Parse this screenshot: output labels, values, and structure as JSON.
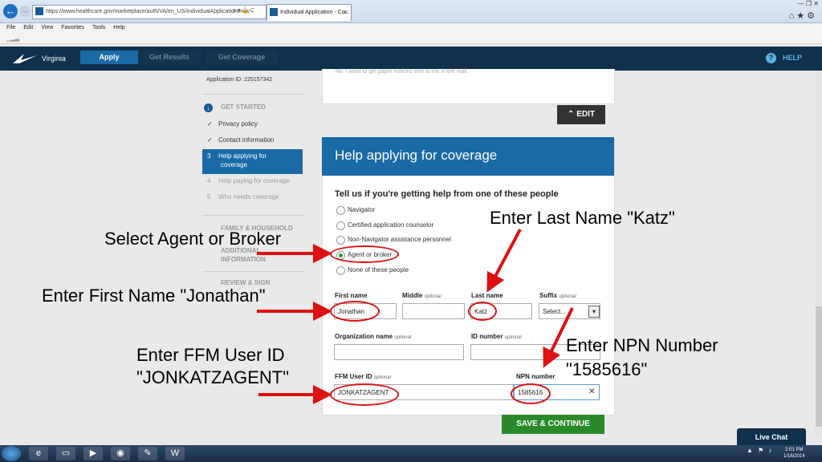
{
  "browser": {
    "url": "https://www.healthcare.gov/marketplace/auth/VA/en_US/individualApplication#nav",
    "url_tools": "ρ ▾ 🔒 C",
    "tab_title": "Individual Application - Co...",
    "menu": [
      "File",
      "Edit",
      "View",
      "Favorites",
      "Tools",
      "Help"
    ],
    "window_controls": "— ❐ ✕",
    "toolbar_icons": "⌂★⚙"
  },
  "header": {
    "state": "Virginia",
    "steps": [
      "Apply",
      "Get Results",
      "Get Coverage"
    ],
    "help": "HELP",
    "help_icon_glyph": "?"
  },
  "sidebar": {
    "application_id": "Application ID: 225157342",
    "section_get_started": "GET STARTED",
    "items": [
      {
        "mark": "✓",
        "label": "Privacy policy"
      },
      {
        "mark": "✓",
        "label": "Contact information"
      },
      {
        "mark": "3",
        "label": "Help applying for",
        "label2": "coverage"
      },
      {
        "mark": "4",
        "label": "Help paying for coverage"
      },
      {
        "mark": "5",
        "label": "Who needs coverage"
      }
    ],
    "section_family": "FAMILY & HOUSEHOLD",
    "section_additional": "ADDITIONAL",
    "section_additional2": "INFORMATION",
    "section_review": "REVIEW & SIGN"
  },
  "prev_card": {
    "faded_text": "No, I want to get paper notices sent to me in the mail.",
    "edit_label": "EDIT"
  },
  "form": {
    "title": "Help applying for coverage",
    "question": "Tell us if you're getting help from one of these people",
    "options": [
      "Navigator",
      "Certified application counselor",
      "Non-Navigator assistance personnel",
      "Agent or broker",
      "None of these people"
    ],
    "selected_option": "Agent or broker",
    "first_name_label": "First name",
    "first_name_value": "Jonathan",
    "middle_label": "Middle",
    "middle_optional": "optional",
    "last_name_label": "Last name",
    "last_name_value": "Katz",
    "suffix_label": "Suffix",
    "suffix_optional": "optional",
    "suffix_value": "Select...",
    "org_label": "Organization name",
    "org_optional": "optional",
    "id_label": "ID number",
    "id_optional": "optional",
    "ffm_label": "FFM User ID",
    "ffm_optional": "optional",
    "ffm_value": "JONKATZAGENT",
    "npn_label": "NPN number",
    "npn_value": "1585616",
    "save_label": "SAVE & CONTINUE"
  },
  "live_chat": "Live Chat",
  "taskbar": {
    "time": "2:01 PM",
    "date": "1/16/2014"
  },
  "annotations": {
    "select_agent": "Select Agent or Broker",
    "enter_first": "Enter First Name \"Jonathan\"",
    "enter_ffm_1": "Enter FFM User ID",
    "enter_ffm_2": "\"JONKATZAGENT\"",
    "enter_last": "Enter Last Name \"Katz\"",
    "enter_npn_1": "Enter NPN Number",
    "enter_npn_2": "\"1585616\""
  },
  "colors": {
    "header_bg": "#10304c",
    "accent_blue": "#1a6aa6",
    "save_green": "#2a8a2a",
    "annotation_red": "#dd1111"
  }
}
